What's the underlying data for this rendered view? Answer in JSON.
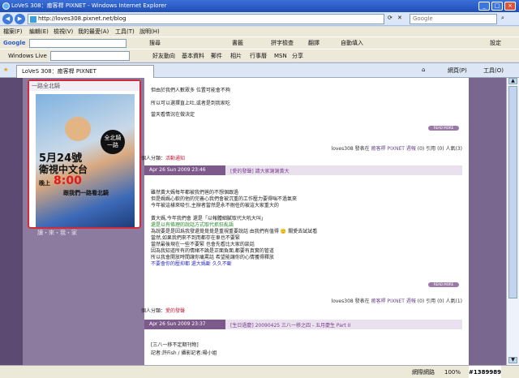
{
  "window": {
    "title": "LoVeS 308：癒客桿 PIXNET - Windows Internet Explorer"
  },
  "address": {
    "url": "http://loves308.pixnet.net/blog",
    "search_placeholder": "Google"
  },
  "menu": [
    "檔案(F)",
    "編輯(E)",
    "檢視(V)",
    "我的最愛(A)",
    "工具(T)",
    "說明(H)"
  ],
  "google_bar": {
    "logo": "Google",
    "items": [
      "搜尋",
      "書籤",
      "拼字檢查",
      "翻譯",
      "自動填入",
      "設定"
    ]
  },
  "wl_bar": {
    "logo": "Windows Live",
    "items": [
      "好友動向",
      "基本資料",
      "郵件",
      "相片",
      "行事曆",
      "MSN",
      "分享"
    ]
  },
  "tab": {
    "title": "LoVeS 308：癒客桿 PIXNET",
    "tools": [
      "網頁(P)",
      "工具(O)"
    ]
  },
  "sidebar": {
    "promo_header": "一路全北騎",
    "promo_date": "5月24號",
    "promo_channel": "衛視中文台",
    "promo_time_prefix": "晚上",
    "promo_time": "8:00",
    "promo_sub": "跟我們一路看北騎",
    "promo_badge": "全北騎 一路",
    "section2": "讀・來・我・家"
  },
  "posts": [
    {
      "lines": [
        "但由於我們人數眾多 位置可能會不夠",
        "所以可以選擇直上吐,或者是到我家吃",
        "當天看情況在做決定"
      ],
      "readmore": "READ MORE",
      "meta": {
        "author": "loves308",
        "posted_in": "發表在",
        "blog": "癒客桿 PIXNET 週報",
        "comments": "(0) 引用 (0) 人氣(3)"
      },
      "category_label": "個人分類：",
      "category": "活動通知"
    },
    {
      "date": "Apr 26 Sun 2009 23:46",
      "title": "[愛的發聲] 請大家謝謝黃大",
      "lines": [
        "雖然黃大媽每年都被我們爸的不想個跟過",
        "但是媽媽心軟的他的完善心我們會被沉重的工作壓力要得喘不過氣來",
        "今年被這樣來吸引,主辦者當然是永不刪任的被這大家重大的"
      ],
      "lines2": [
        "黃大媽,今年我們會 還是「以報體細膩取代大吼大叫」",
        "還是以有條理的說話方式取代抓狂亂語",
        "為說要是是因爲我發還覺覺覺是重視重要說話 由我們有值得 🙂 關愛去試試看",
        "當然,如果我們來不到而都存在車也不要緊",
        "當然最後現在一些不要緊 也會先看比大家的談話",
        "因為我知道所有的情緒不論是正面負面,都要有真實的管道",
        "所以我會開放時間讓你痛罵話 希望能讓你的心情獲得釋放",
        "不要會你的壓抑都 還大媽斷 久久不斷"
      ],
      "readmore": "READ MORE",
      "meta": {
        "author": "loves308",
        "posted_in": "發表在",
        "blog": "癒客桿 PIXNET 週報",
        "comments": "(0) 引用 (0) 人氣(1)"
      },
      "category_label": "個人分類：",
      "category": "愛的發聲"
    },
    {
      "date": "Apr 26 Sun 2009 23:37",
      "title": "[生日過慶] 20090425 三八一移之四 - 五月慶生 Part II",
      "lines": [
        "[三八一移不定期刊物]",
        "記者:許Fish / 攝影記者:楊小姐"
      ]
    }
  ],
  "status": {
    "zone": "網際網路",
    "zoom": "100%",
    "watermark": "#1389989"
  }
}
